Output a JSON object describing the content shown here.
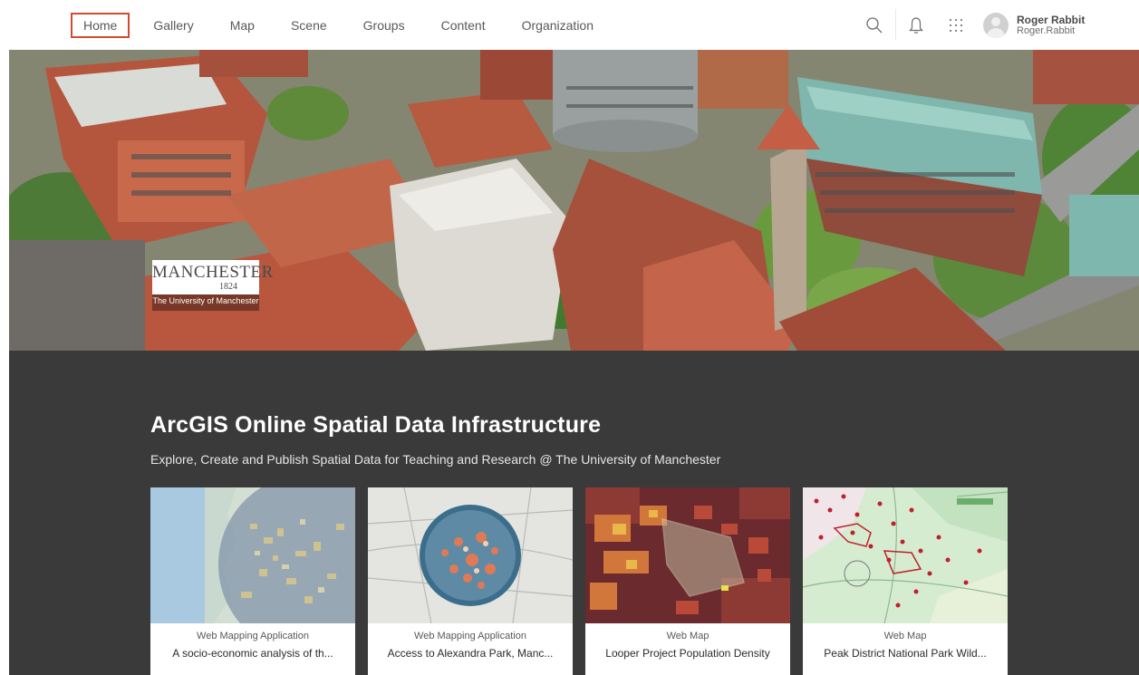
{
  "nav": {
    "items": [
      {
        "label": "Home",
        "active": true
      },
      {
        "label": "Gallery",
        "active": false
      },
      {
        "label": "Map",
        "active": false
      },
      {
        "label": "Scene",
        "active": false
      },
      {
        "label": "Groups",
        "active": false
      },
      {
        "label": "Content",
        "active": false
      },
      {
        "label": "Organization",
        "active": false
      }
    ],
    "icons": [
      "search-icon",
      "bell-icon",
      "app-launcher-icon"
    ],
    "user": {
      "name": "Roger Rabbit",
      "login": "Roger.Rabbit"
    }
  },
  "banner": {
    "logo": {
      "word": "MANCHESTER",
      "year": "1824",
      "subtitle": "The University of Manchester"
    }
  },
  "main": {
    "title": "ArcGIS Online Spatial Data Infrastructure",
    "subtitle": "Explore, Create and Publish Spatial Data for Teaching and Research @ The University of Manchester"
  },
  "cards": [
    {
      "type": "Web Mapping Application",
      "title": "A socio-economic analysis of th..."
    },
    {
      "type": "Web Mapping Application",
      "title": "Access to Alexandra Park, Manc..."
    },
    {
      "type": "Web Map",
      "title": "Looper Project Population Density"
    },
    {
      "type": "Web Map",
      "title": "Peak District National Park Wild..."
    }
  ],
  "colors": {
    "active_nav_border": "#d24a31",
    "content_bg": "#3a3a3a",
    "title_text": "#ffffff"
  }
}
